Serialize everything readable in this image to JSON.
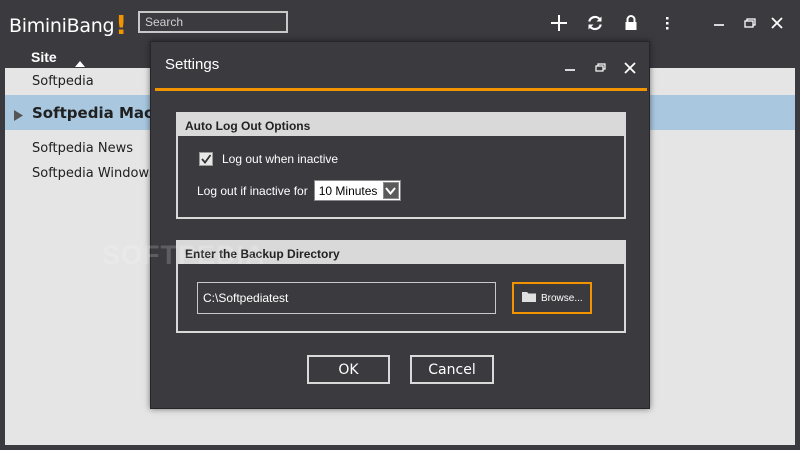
{
  "app": {
    "logo_text": "BiminiBang",
    "logo_mark": "!",
    "search_placeholder": "Search",
    "toolbar_icons": [
      "plus-icon",
      "refresh-icon",
      "lock-icon",
      "more-vertical-icon"
    ],
    "window_controls": [
      "minimize-icon",
      "restore-icon",
      "close-icon"
    ]
  },
  "list": {
    "column_header": "Site",
    "sort": "ascending",
    "items": [
      {
        "label": "Softpedia",
        "selected": false
      },
      {
        "label": "Softpedia Mac",
        "selected": true
      },
      {
        "label": "Softpedia News",
        "selected": false
      },
      {
        "label": "Softpedia Windows",
        "selected": false
      }
    ]
  },
  "dialog": {
    "title": "Settings",
    "autologout": {
      "heading": "Auto Log Out Options",
      "checkbox_label": "Log out when inactive",
      "checkbox_checked": true,
      "inactive_label": "Log out if inactive for",
      "inactive_value": "10 Minutes"
    },
    "backup": {
      "heading": "Enter the Backup Directory",
      "path_value": "C:\\Softpediatest",
      "browse_label": "Browse..."
    },
    "ok_label": "OK",
    "cancel_label": "Cancel"
  },
  "colors": {
    "background": "#3b3a3f",
    "accent": "#f29400",
    "list_background": "#e5e5e5",
    "selection": "#a9c8e0",
    "group_header": "#d9d9d9"
  },
  "watermark": "SOFTPEDIA"
}
